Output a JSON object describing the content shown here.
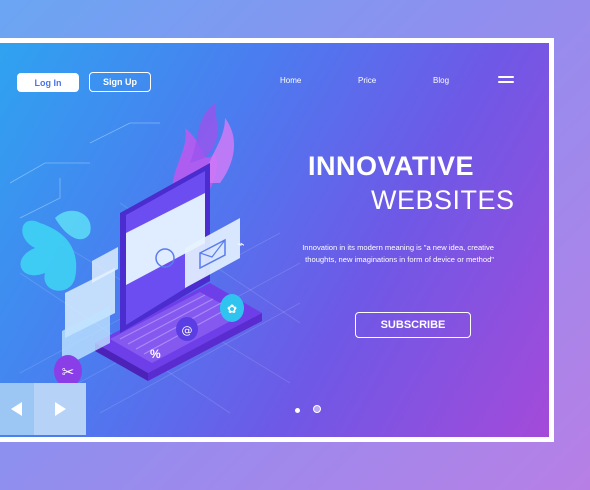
{
  "header": {
    "login_label": "Log In",
    "signup_label": "Sign Up",
    "nav": [
      "Home",
      "Price",
      "Blog"
    ]
  },
  "hero": {
    "title_line1": "INNOVATIVE",
    "title_line2": "WEBSITES",
    "description": "Innovation in its modern meaning is \"a new idea, creative thoughts, new imaginations in form of device or method\"",
    "cta_label": "SUBSCRIBE",
    "illustration_badge": "%"
  },
  "slider": {
    "dots": 2,
    "active_dot": 2
  },
  "icons": [
    "menu-icon",
    "prev-arrow-icon",
    "next-arrow-icon",
    "scissors-icon",
    "brain-icon",
    "mail-icon",
    "wifi-icon",
    "bulb-icon",
    "at-icon"
  ],
  "colors": {
    "hero_start": "#2fa3f0",
    "hero_end": "#a44ad9",
    "accent": "#4a74ea"
  }
}
